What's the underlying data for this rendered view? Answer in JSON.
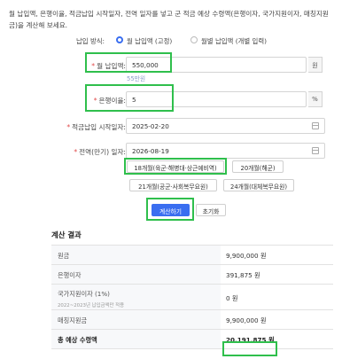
{
  "intro_text": "월 납입액, 은행이율, 적금납입 시작일자, 전역 일자를 넣고 군 적금 예상 수령액(은행이자, 국가지원이자, 매칭지원금)을 계산해 보세요.",
  "payment_mode": {
    "label": "납입 방식:",
    "options": [
      {
        "label": "월 납입액 (고정)",
        "checked": true
      },
      {
        "label": "월별 납입액 (개별 입력)",
        "checked": false
      }
    ]
  },
  "fields": {
    "monthly": {
      "label": "월 납입액:",
      "value": "550,000",
      "unit": "원",
      "hint": "55만원"
    },
    "rate": {
      "label": "은행이율:",
      "value": "5",
      "unit": "%"
    },
    "start": {
      "label": "적금납입 시작일자:",
      "value": "2025-02-20"
    },
    "end": {
      "label": "전역(만기) 일자:",
      "value": "2026-08-19"
    }
  },
  "duration_options": [
    "18개월(육군·해병대·상근예비역)",
    "20개월(해군)",
    "21개월(공군·사회복무요원)",
    "24개월(대체복무요원)"
  ],
  "buttons": {
    "calculate": "계산하기",
    "reset": "초기화"
  },
  "results": {
    "title": "계산 결과",
    "rows": [
      {
        "label": "원금",
        "value": "9,900,000 원"
      },
      {
        "label": "은행이자",
        "value": "391,875 원"
      },
      {
        "label": "국가지원이자 (1%)",
        "note": "2022~2023년 납입금액만 적용",
        "value": "0 원"
      },
      {
        "label": "매칭지원금",
        "value": "9,900,000 원"
      },
      {
        "label": "총 예상 수령액",
        "value": "20,191,875 원"
      }
    ]
  },
  "colors": {
    "primary": "#3a6ef0",
    "highlight": "#2fbf4c",
    "required": "#e04848"
  }
}
